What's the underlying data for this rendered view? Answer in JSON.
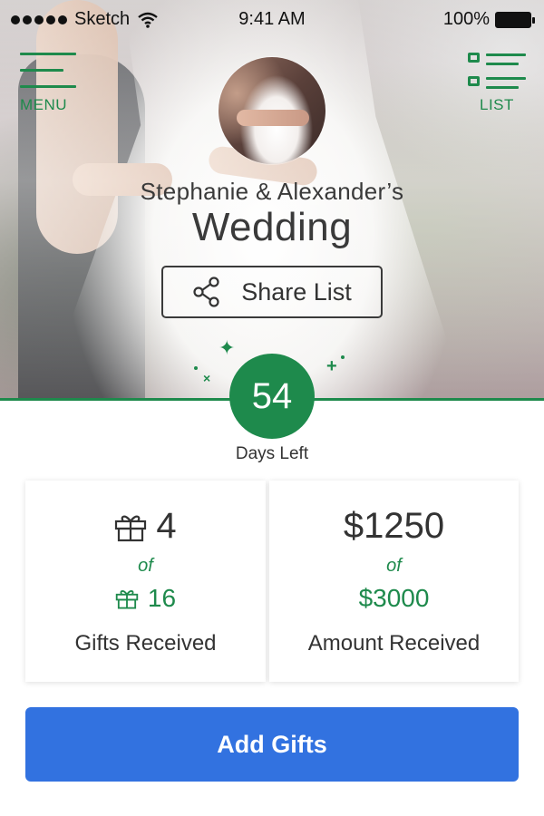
{
  "status_bar": {
    "carrier": "Sketch",
    "time": "9:41 AM",
    "battery": "100%"
  },
  "nav": {
    "menu_label": "MENU",
    "list_label": "LIST"
  },
  "header": {
    "names": "Stephanie & Alexander’s",
    "event": "Wedding",
    "share_label": "Share List"
  },
  "countdown": {
    "days": "54",
    "caption": "Days Left"
  },
  "stats": {
    "gifts": {
      "received": "4",
      "of": "of",
      "total": "16",
      "caption": "Gifts Received"
    },
    "amount": {
      "received": "$1250",
      "of": "of",
      "total": "$3000",
      "caption": "Amount Received"
    }
  },
  "actions": {
    "add_gifts_label": "Add Gifts"
  },
  "colors": {
    "accent_green": "#1e8a4c",
    "primary_blue": "#3272e0",
    "text_dark": "#333333"
  },
  "icons": {
    "menu": "hamburger-icon",
    "list": "list-icon",
    "share": "share-icon",
    "gift": "gift-icon",
    "wifi": "wifi-icon",
    "battery": "battery-icon"
  }
}
